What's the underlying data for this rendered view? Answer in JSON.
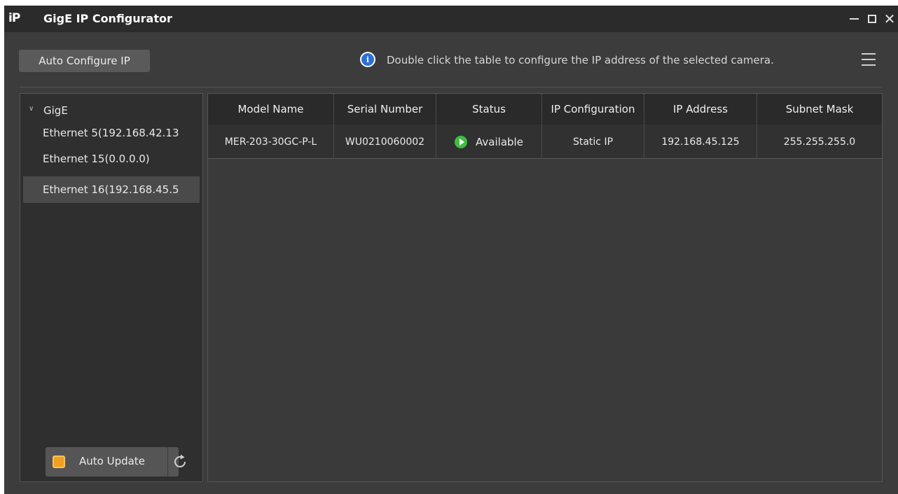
{
  "titlebar": {
    "logo": "iP",
    "title": "GigE IP Configurator",
    "close_glyph": "✕"
  },
  "toolbar": {
    "auto_configure_label": "Auto Configure IP",
    "info_text": "Double click the table to configure the IP address of the selected camera."
  },
  "sidebar": {
    "root_label": "GigE",
    "items": [
      {
        "label": "Ethernet 5(192.168.42.13",
        "selected": false
      },
      {
        "label": "Ethernet 15(0.0.0.0)",
        "selected": false
      },
      {
        "label": "Ethernet 16(192.168.45.5",
        "selected": true
      }
    ],
    "auto_update_label": "Auto Update",
    "auto_update_checked": true
  },
  "table": {
    "columns": [
      "Model Name",
      "Serial Number",
      "Status",
      "IP Configuration",
      "IP Address",
      "Subnet Mask"
    ],
    "rows": [
      {
        "model_name": "MER-203-30GC-P-L",
        "serial_number": "WU0210060002",
        "status": "Available",
        "ip_configuration": "Static IP",
        "ip_address": "192.168.45.125",
        "subnet_mask": "255.255.255.0"
      }
    ]
  },
  "icons": {
    "info": "info-circle-icon",
    "menu": "hamburger-menu-icon",
    "refresh": "refresh-icon",
    "status": "play-circle-icon"
  },
  "colors": {
    "window_bg": "#3c3c3c",
    "titlebar_bg": "#2b2b2b",
    "checkbox_accent": "#f0a01e",
    "status_available": "#3fbf3f",
    "info_blue": "#2f6fd6"
  }
}
